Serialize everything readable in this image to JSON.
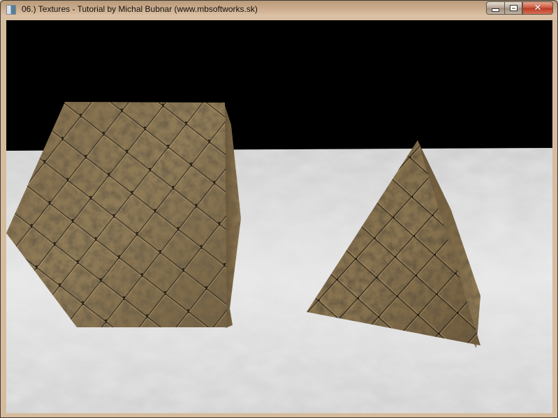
{
  "window": {
    "title": "06.) Textures - Tutorial by Michal Bubnar (www.mbsoftworks.sk)",
    "controls": {
      "minimize": "minimize",
      "maximize": "maximize",
      "close": "close"
    }
  },
  "scene": {
    "sky_color": "#000000",
    "floor_color": "#d8d8d8",
    "objects": [
      {
        "name": "textured-cube",
        "texture": "cracked diamond-pattern stone tiles"
      },
      {
        "name": "textured-pyramid",
        "texture": "cracked diamond-pattern stone tiles"
      }
    ]
  }
}
